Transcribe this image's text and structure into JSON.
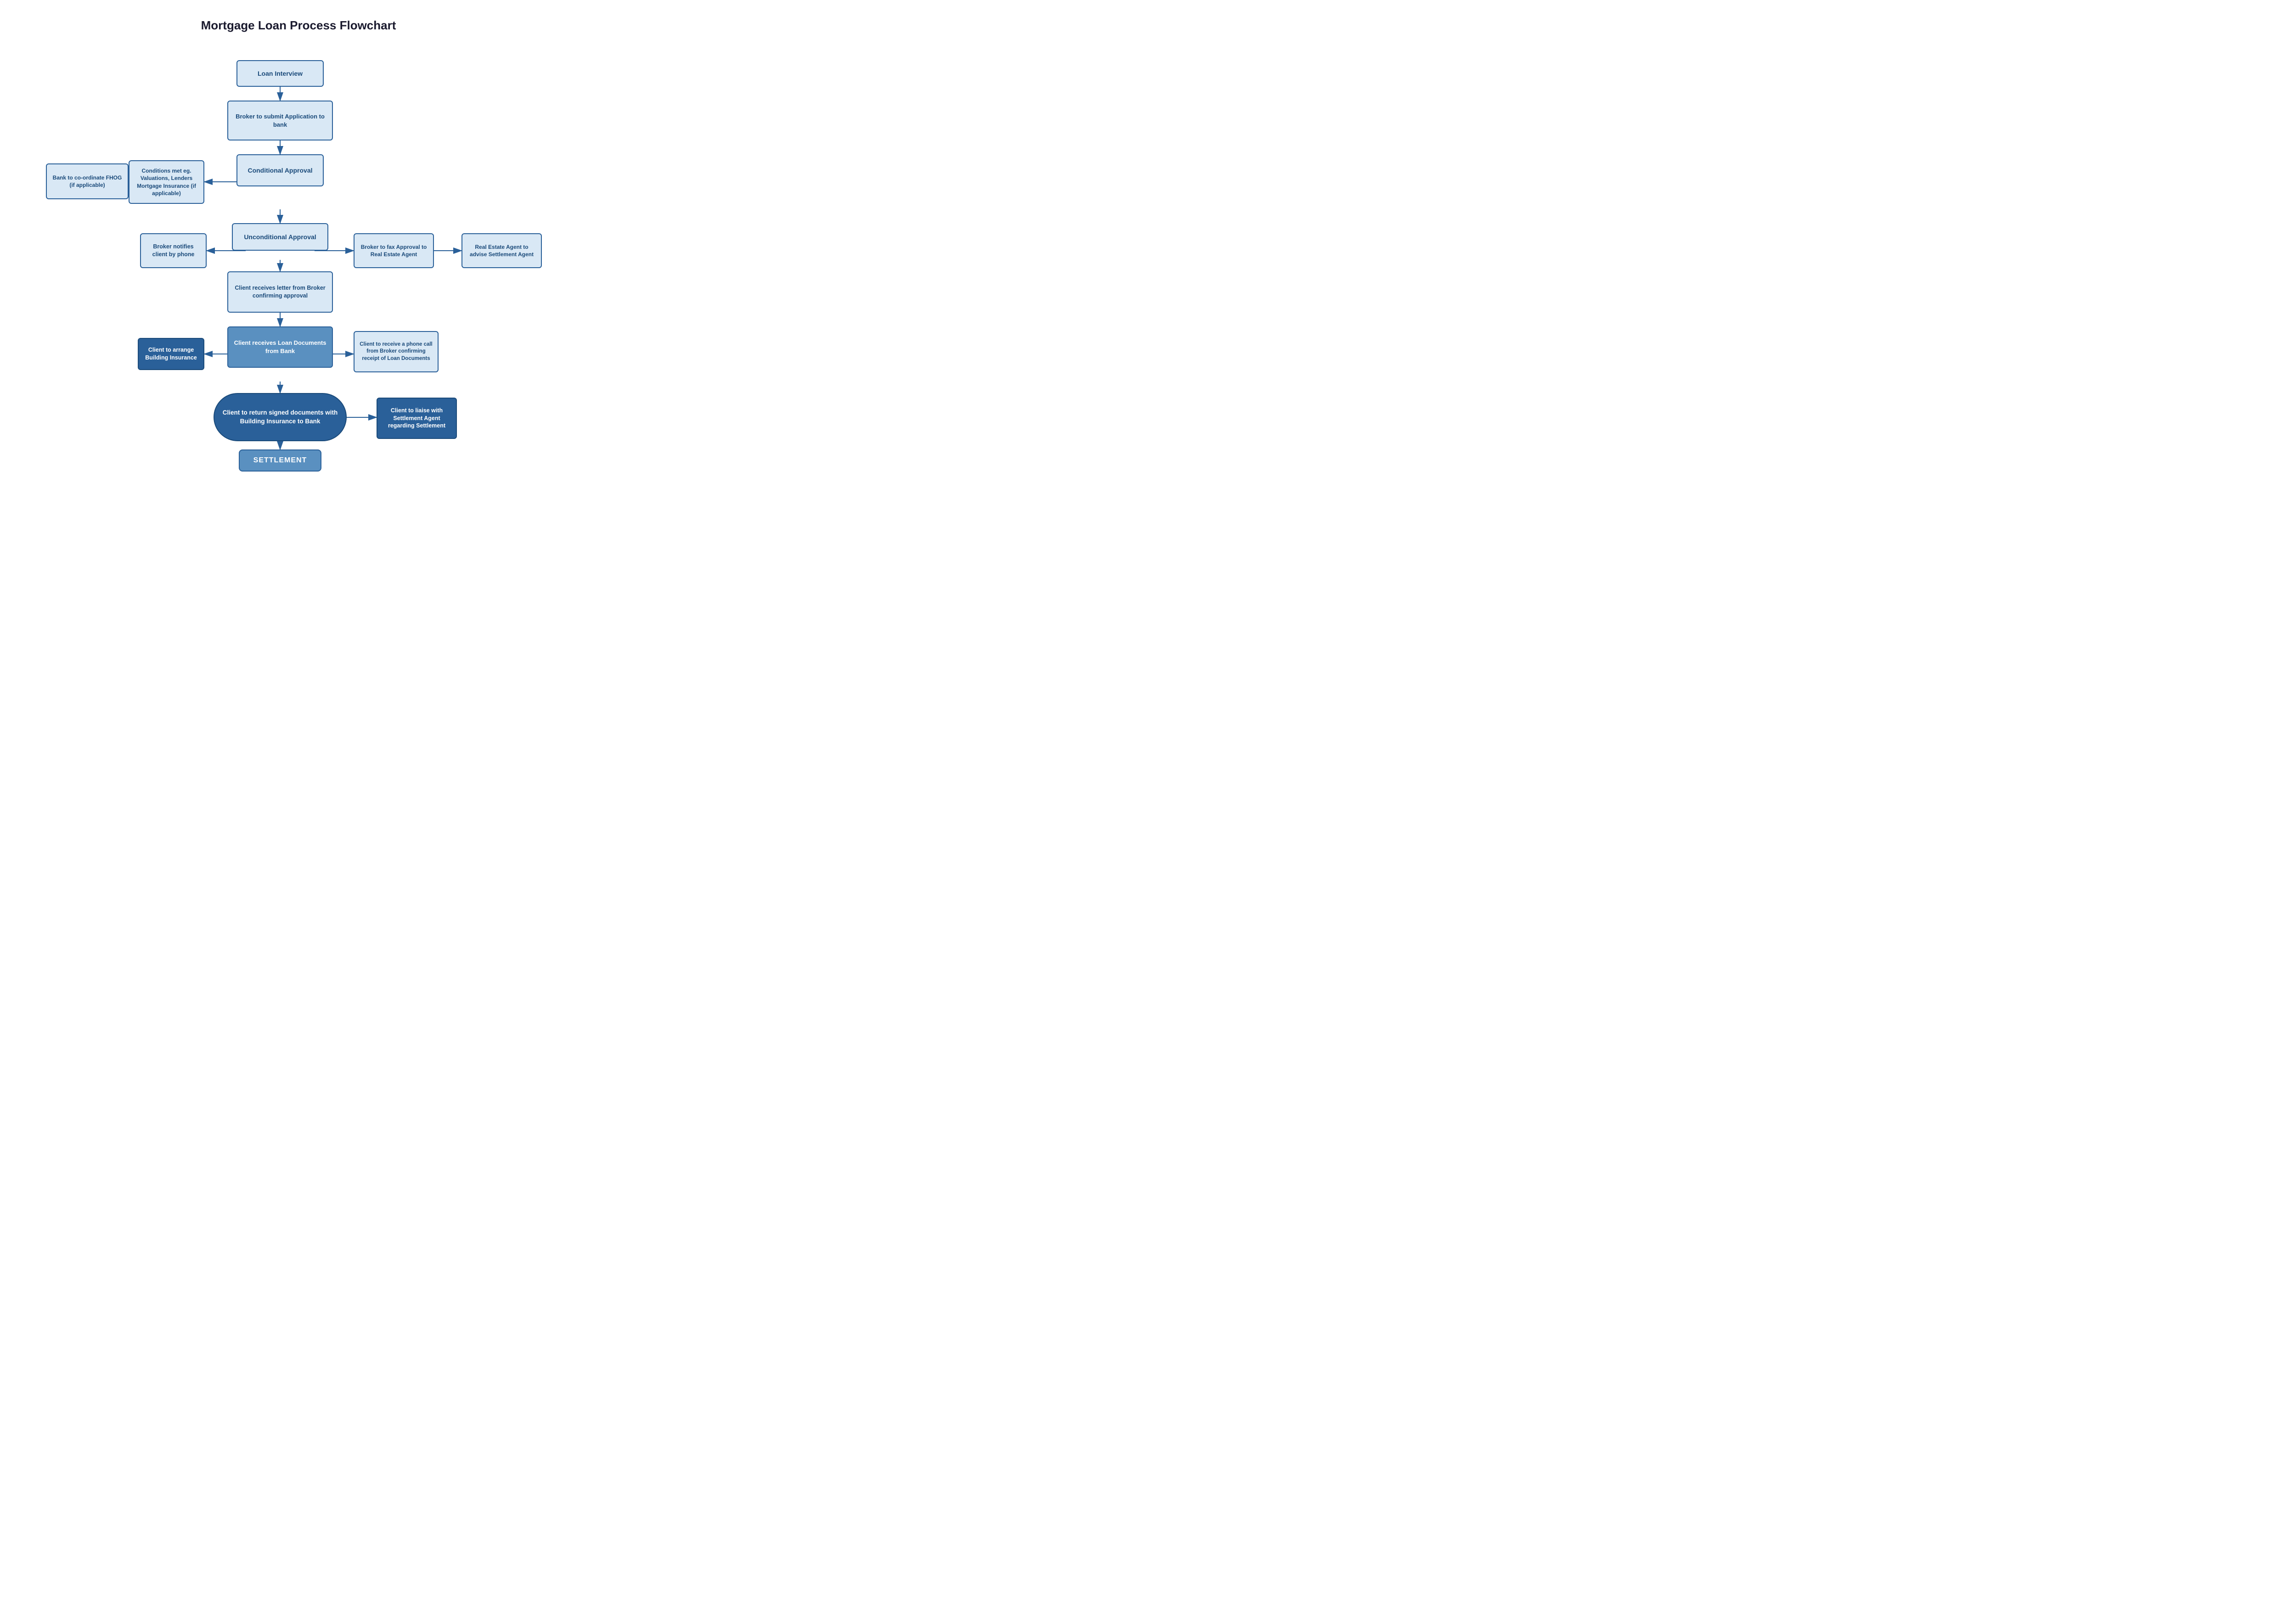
{
  "title": "Mortgage Loan Process Flowchart",
  "nodes": {
    "loan_interview": "Loan Interview",
    "broker_submit": "Broker to submit Application to bank",
    "conditional_approval": "Conditional Approval",
    "conditions_met": "Conditions met eg. Valuations, Lenders Mortgage Insurance (if applicable)",
    "bank_fhog": "Bank to co-ordinate FHOG (if applicable)",
    "unconditional_approval": "Unconditional Approval",
    "broker_notifies": "Broker notifies client by phone",
    "client_receives_letter": "Client receives letter from Broker confirming approval",
    "broker_fax": "Broker to fax Approval to Real Estate Agent",
    "real_estate_agent": "Real Estate Agent to advise Settlement Agent",
    "client_arrange_insurance": "Client to arrange Building Insurance",
    "client_loan_docs": "Client receives Loan Documents from Bank",
    "client_phone_call": "Client to receive a phone call from Broker confirming receipt of Loan Documents",
    "client_return_docs": "Client to return signed documents with Building Insurance to Bank",
    "client_liaise": "Client to liaise with Settlement Agent regarding Settlement",
    "settlement": "SETTLEMENT"
  }
}
